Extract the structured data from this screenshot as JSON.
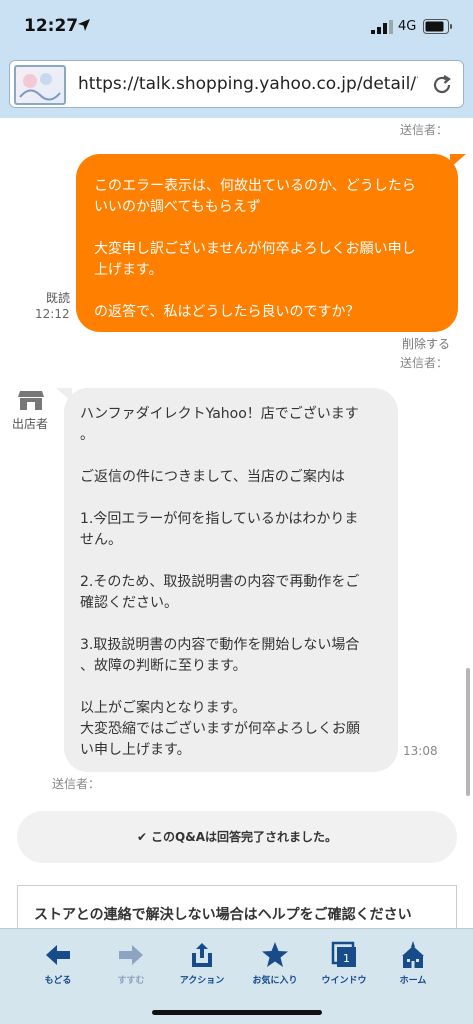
{
  "status_bar": {
    "time": "12:27",
    "network": "4G"
  },
  "browser": {
    "url": "https://talk.shopping.yahoo.co.jp/detail/75..."
  },
  "chat": {
    "top_sender": "送信者：",
    "user_message": {
      "lines": [
        "このエラー表示は、何故出ているのか、どうしたら\nいいのか調べてももらえず",
        "大変申し訳ございませんが何卒よろしくお願い申し\n上げます。",
        "の返答で、私はどうしたら良いのですか？"
      ],
      "read_label": "既読",
      "time": "12:12",
      "delete_label": "削除する",
      "sender_label": "送信者："
    },
    "shop_message": {
      "avatar_label": "出店者",
      "lines": [
        "ハンファダイレクトYahoo！店でございます\n。",
        "ご返信の件につきまして、当店のご案内は",
        "1.今回エラーが何を指しているかはわかりま\nせん。",
        "2.そのため、取扱説明書の内容で再動作をご\n確認ください。",
        "3.取扱説明書の内容で動作を開始しない場合\n、故障の判断に至ります。",
        "以上がご案内となります。\n大変恐縮ではございますが何卒よろしくお願\nい申し上げます。"
      ],
      "time": "13:08",
      "sender_label": "送信者："
    },
    "completed_notice": "このQ&Aは回答完了されました。",
    "help_notice": "ストアとの連絡で解決しない場合はヘルプをご確認ください"
  },
  "toolbar": {
    "items": [
      {
        "label": "もどる",
        "icon": "back-arrow-icon"
      },
      {
        "label": "すすむ",
        "icon": "forward-arrow-icon"
      },
      {
        "label": "アクション",
        "icon": "share-icon"
      },
      {
        "label": "お気に入り",
        "icon": "star-icon"
      },
      {
        "label": "ウインドウ",
        "icon": "window-icon",
        "badge": "1"
      },
      {
        "label": "ホーム",
        "icon": "home-icon"
      }
    ]
  },
  "colors": {
    "accent": "#ff7f00",
    "toolbar_bg": "#d4e5ee",
    "toolbar_text": "#174b8a",
    "header_bg": "#c9e1f3"
  }
}
